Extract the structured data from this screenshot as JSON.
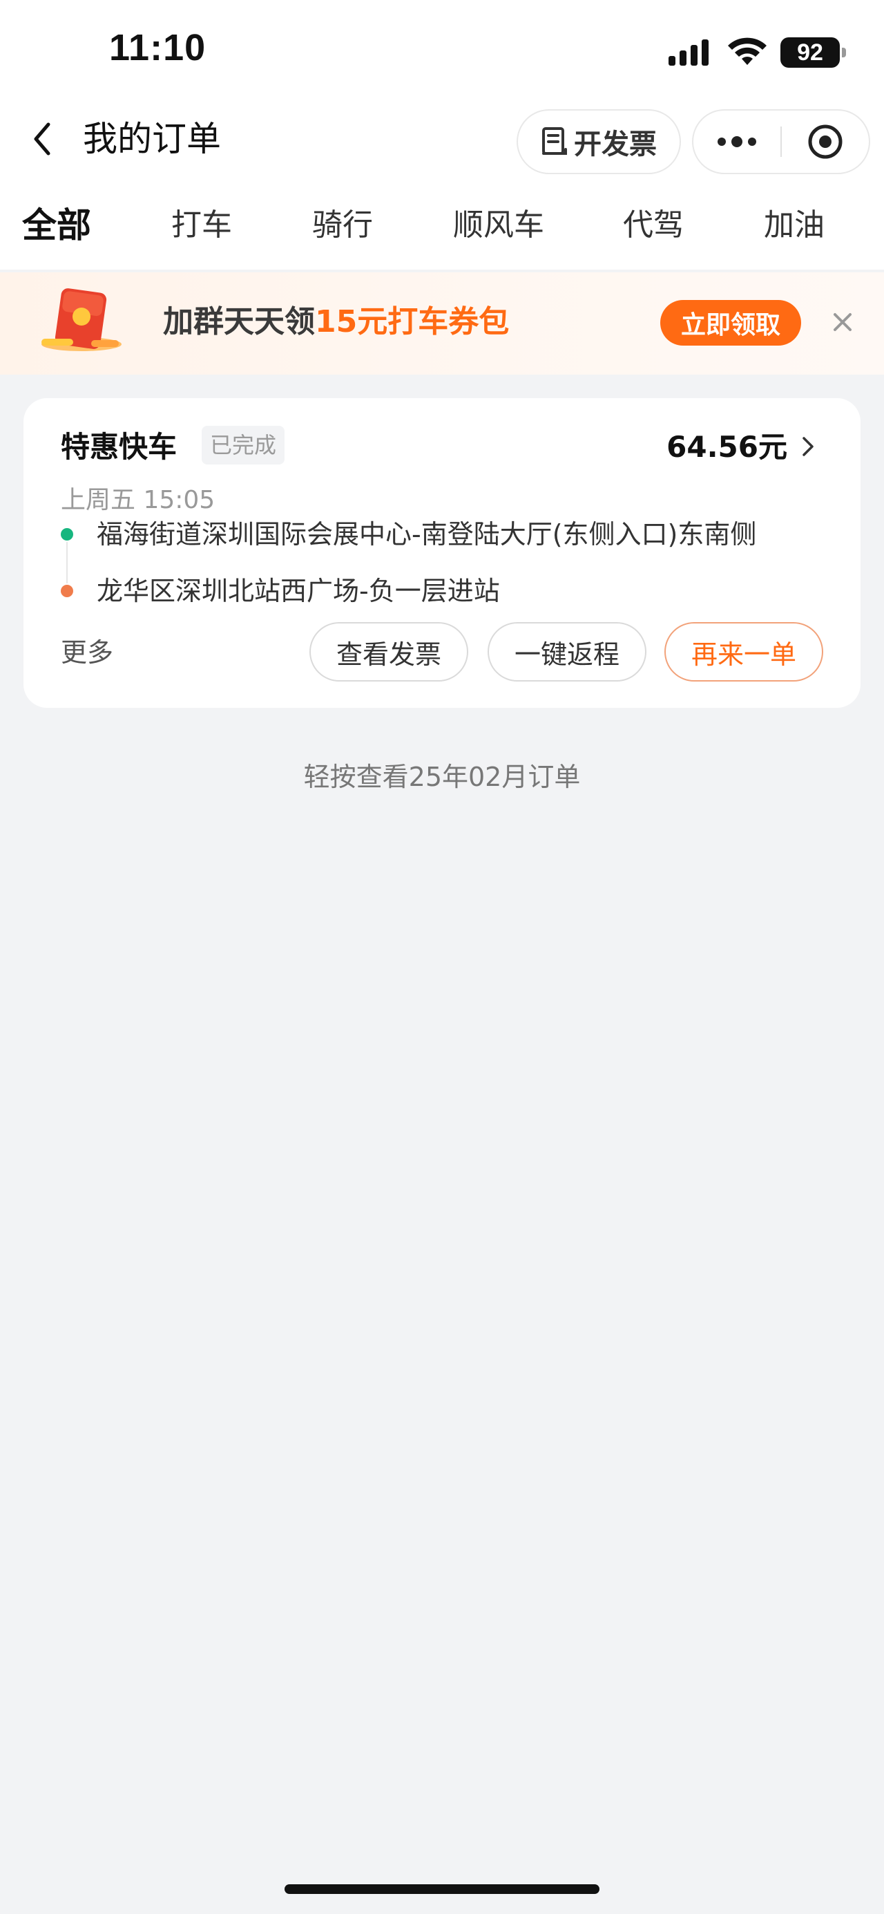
{
  "status_bar": {
    "time": "11:10",
    "battery": "92",
    "icons": [
      "signal-icon",
      "wifi-icon",
      "battery-icon"
    ]
  },
  "nav": {
    "title": "我的订单",
    "invoice_label": "开发票",
    "icons": [
      "back-icon",
      "invoice-icon",
      "more-icon",
      "target-icon"
    ]
  },
  "tabs": [
    {
      "label": "全部",
      "active": true
    },
    {
      "label": "打车",
      "active": false
    },
    {
      "label": "骑行",
      "active": false
    },
    {
      "label": "顺风车",
      "active": false
    },
    {
      "label": "代驾",
      "active": false
    },
    {
      "label": "加油",
      "active": false
    }
  ],
  "promo": {
    "text_prefix": "加群天天领",
    "text_highlight": "15元打车券包",
    "button_label": "立即领取",
    "icon": "red-envelope-icon",
    "close_icon": "close-icon"
  },
  "order": {
    "type": "特惠快车",
    "status": "已完成",
    "price": "64.56元",
    "time": "上周五 15:05",
    "from": "福海街道深圳国际会展中心-南登陆大厅(东侧入口)东南侧",
    "to": "龙华区深圳北站西广场-负一层进站",
    "more_label": "更多",
    "actions": [
      "查看发票",
      "一键返程",
      "再来一单"
    ]
  },
  "month_link": "轻按查看25年02月订单",
  "colors": {
    "accent": "#ff6a13",
    "background": "#f2f3f5",
    "start_dot": "#17b67f",
    "end_dot": "#f07c4b"
  }
}
